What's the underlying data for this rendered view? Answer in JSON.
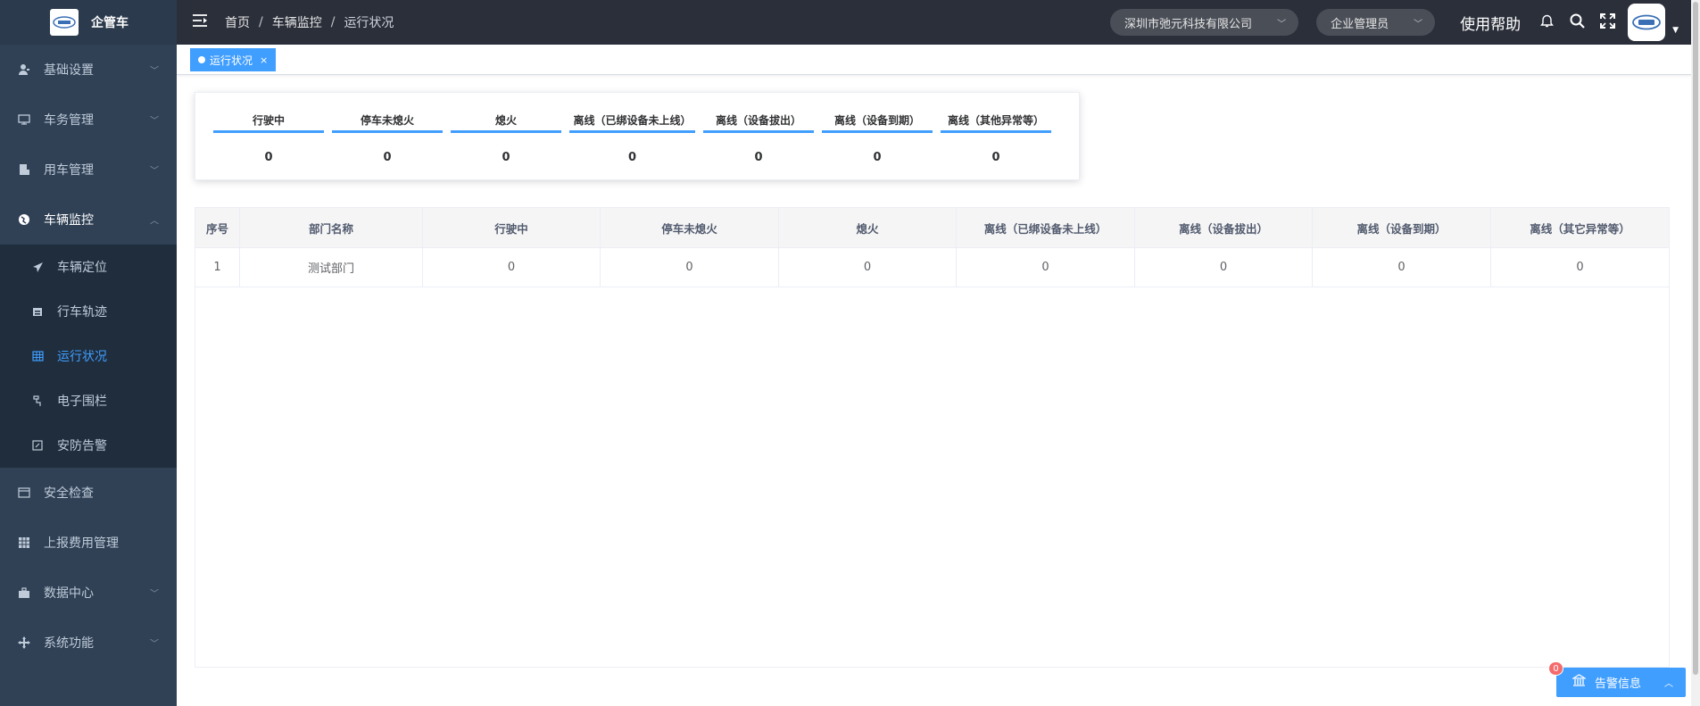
{
  "app": {
    "title": "企管车"
  },
  "sidebar": {
    "items": [
      {
        "label": "基础设置",
        "icon": "user-icon"
      },
      {
        "label": "车务管理",
        "icon": "monitor-icon"
      },
      {
        "label": "用车管理",
        "icon": "document-icon"
      },
      {
        "label": "车辆监控",
        "icon": "globe-icon"
      },
      {
        "label": "安全检查",
        "icon": "card-icon"
      },
      {
        "label": "上报费用管理",
        "icon": "grid-icon"
      },
      {
        "label": "数据中心",
        "icon": "briefcase-icon"
      },
      {
        "label": "系统功能",
        "icon": "move-icon"
      }
    ],
    "monitor_sub": [
      {
        "label": "车辆定位",
        "icon": "send-icon"
      },
      {
        "label": "行车轨迹",
        "icon": "calendar-icon"
      },
      {
        "label": "运行状况",
        "icon": "table-icon"
      },
      {
        "label": "电子围栏",
        "icon": "fence-icon"
      },
      {
        "label": "安防告警",
        "icon": "edit-icon"
      }
    ]
  },
  "header": {
    "breadcrumb": [
      "首页",
      "车辆监控",
      "运行状况"
    ],
    "company": "深圳市弛元科技有限公司",
    "role": "企业管理员",
    "help": "使用帮助"
  },
  "tags": [
    {
      "label": "运行状况",
      "close": "×"
    }
  ],
  "stats": [
    {
      "label": "行驶中",
      "value": "0"
    },
    {
      "label": "停车未熄火",
      "value": "0"
    },
    {
      "label": "熄火",
      "value": "0"
    },
    {
      "label": "离线（已绑设备未上线）",
      "value": "0"
    },
    {
      "label": "离线（设备拔出）",
      "value": "0"
    },
    {
      "label": "离线（设备到期）",
      "value": "0"
    },
    {
      "label": "离线（其他异常等）",
      "value": "0"
    }
  ],
  "table": {
    "columns": [
      "序号",
      "部门名称",
      "行驶中",
      "停车未熄火",
      "熄火",
      "离线（已绑设备未上线）",
      "离线（设备拔出）",
      "离线（设备到期）",
      "离线（其它异常等）"
    ],
    "rows": [
      [
        "1",
        "测试部门",
        "0",
        "0",
        "0",
        "0",
        "0",
        "0",
        "0"
      ]
    ]
  },
  "alarm": {
    "label": "告警信息",
    "count": "0"
  },
  "colors": {
    "accent": "#409eff",
    "sidebar": "#304156",
    "header": "#2b2f3a"
  }
}
